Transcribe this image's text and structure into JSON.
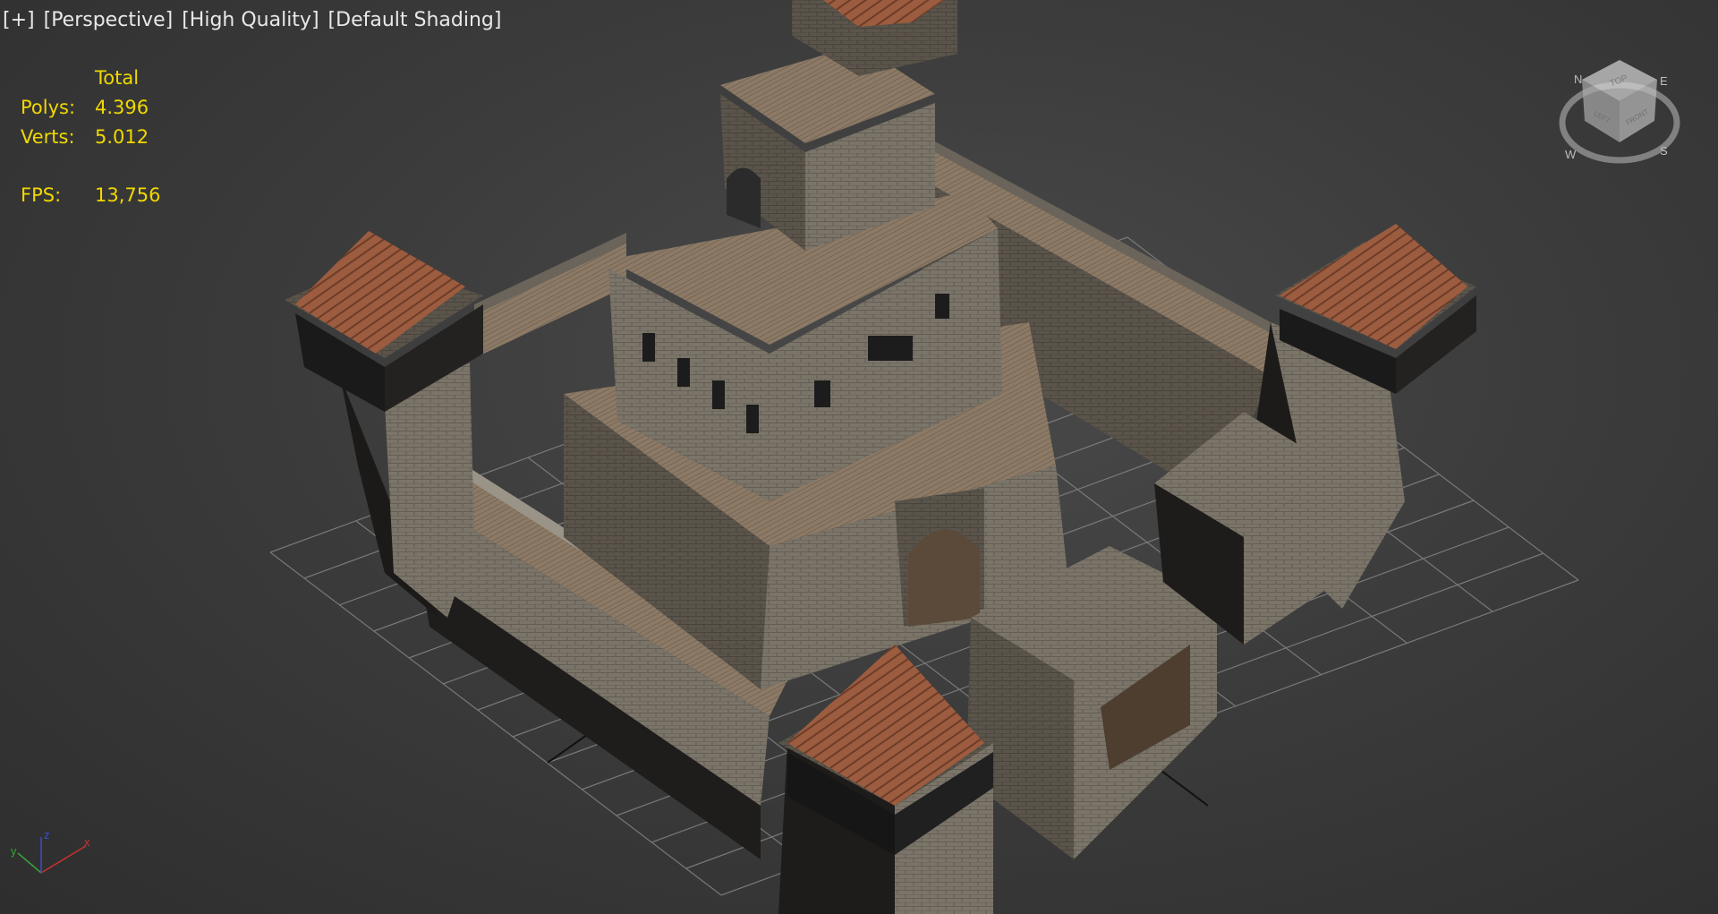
{
  "viewport": {
    "labels": [
      "[+]",
      "[Perspective]",
      "[High Quality]",
      "[Default Shading]"
    ],
    "stats": {
      "header": "Total",
      "rows": [
        {
          "label": "Polys:",
          "value": "4.396"
        },
        {
          "label": "Verts:",
          "value": "5.012"
        }
      ],
      "fps_label": "FPS:",
      "fps_value": "13,756"
    },
    "viewcube": {
      "top": "TOP",
      "left": "LEFT",
      "front": "FRONT",
      "compass": [
        "N",
        "E",
        "S",
        "W"
      ]
    },
    "axis_tripod": {
      "x": "x",
      "y": "y",
      "z": "z"
    }
  },
  "colors": {
    "stats_text": "#f0d800",
    "label_text": "#e8e8e8",
    "background": "#3c3c3c",
    "grid": "#8a8a8a",
    "stone": "#7d766c",
    "wood": "#8e7d6a",
    "roof": "#9a5a3e"
  }
}
